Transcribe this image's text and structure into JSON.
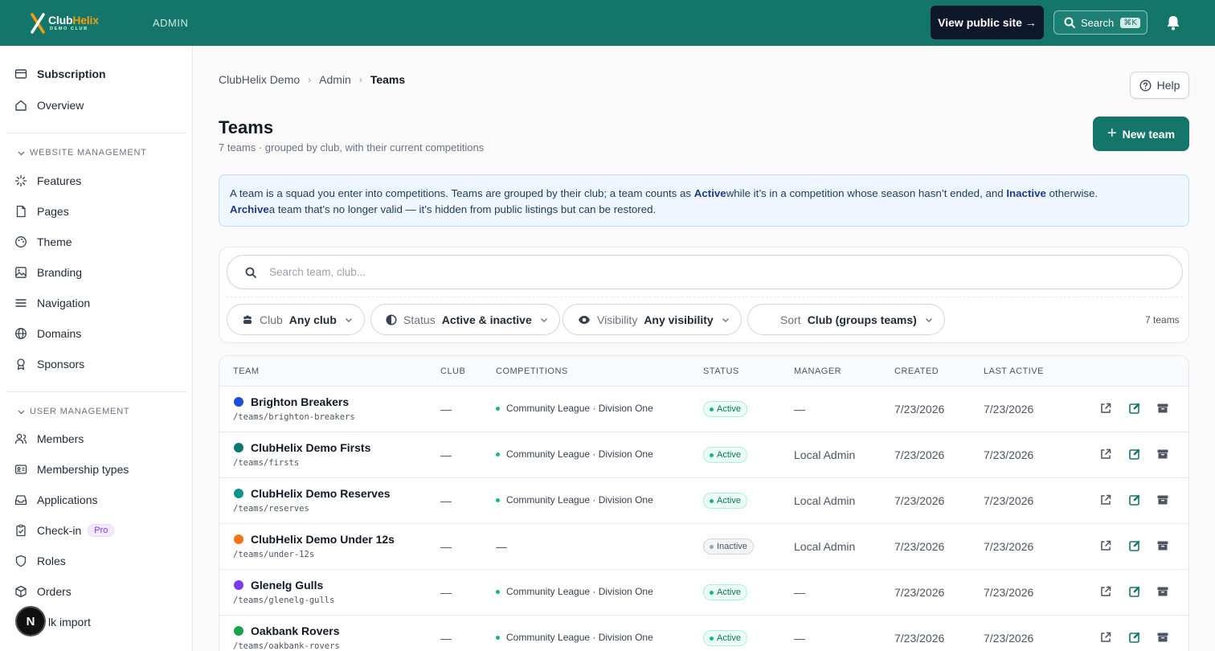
{
  "app": {
    "logo_name_a": "Club",
    "logo_name_b": "Helix",
    "logo_sub": "DEMO CLUB",
    "section": "ADMIN",
    "view_public": "View public site →",
    "search_label": "Search",
    "search_kbd": "⌘K",
    "accent": "#14756b"
  },
  "sidebar": {
    "top_items": [
      {
        "label": "Subscription",
        "icon": "card-icon"
      },
      {
        "label": "Overview",
        "icon": "house-icon"
      }
    ],
    "website_section": "WEBSITE MANAGEMENT",
    "website_items": [
      {
        "label": "Features",
        "icon": "sparkle-icon"
      },
      {
        "label": "Pages",
        "icon": "file-icon"
      },
      {
        "label": "Theme",
        "icon": "palette-icon"
      },
      {
        "label": "Branding",
        "icon": "image-icon"
      },
      {
        "label": "Navigation",
        "icon": "menu-icon"
      },
      {
        "label": "Domains",
        "icon": "globe-icon"
      },
      {
        "label": "Sponsors",
        "icon": "award-icon"
      }
    ],
    "user_section": "USER MANAGEMENT",
    "user_items": [
      {
        "label": "Members",
        "icon": "users-icon"
      },
      {
        "label": "Membership types",
        "icon": "id-card-icon"
      },
      {
        "label": "Applications",
        "icon": "inbox-icon"
      },
      {
        "label": "Check-in",
        "icon": "clipboard-check-icon",
        "badge": "Pro"
      },
      {
        "label": "Roles",
        "icon": "shield-icon"
      },
      {
        "label": "Orders",
        "icon": "box-icon"
      },
      {
        "label": "lk import",
        "icon": "upload-icon"
      }
    ],
    "avatar_letter": "N"
  },
  "breadcrumb": [
    "ClubHelix Demo",
    "Admin",
    "Teams"
  ],
  "help_label": "Help",
  "page": {
    "title": "Teams",
    "subtitle": "7 teams · grouped by club, with their current competitions",
    "new_button": "New team"
  },
  "info": {
    "t1": "A team is a squad you enter into competitions. Teams are grouped by their club; a team counts as ",
    "b1": "Active",
    "t2": "while it’s in a competition whose season hasn’t ended, and ",
    "b2": "Inactive",
    "t3": " otherwise.",
    "b3": "Archive",
    "t4": "a team that’s no longer valid — it’s hidden from public listings but can be restored."
  },
  "filters": {
    "search_placeholder": "Search team, club...",
    "club_label": "Club",
    "club_value": "Any club",
    "status_label": "Status",
    "status_value": "Active & inactive",
    "visibility_label": "Visibility",
    "visibility_value": "Any visibility",
    "sort_label": "Sort",
    "sort_value": "Club (groups teams)",
    "count": "7 teams"
  },
  "table": {
    "columns": [
      "TEAM",
      "CLUB",
      "COMPETITIONS",
      "STATUS",
      "MANAGER",
      "CREATED",
      "LAST ACTIVE"
    ],
    "rows": [
      {
        "name": "Brighton Breakers",
        "slug": "/teams/brighton-breakers",
        "color": "#1d4ed8",
        "club": "—",
        "competition": "Community League · Division One",
        "status": "Active",
        "manager": "—",
        "created": "7/23/2026",
        "last_active": "7/23/2026"
      },
      {
        "name": "ClubHelix Demo Firsts",
        "slug": "/teams/firsts",
        "color": "#0f766e",
        "club": "—",
        "competition": "Community League · Division One",
        "status": "Active",
        "manager": "Local Admin",
        "created": "7/23/2026",
        "last_active": "7/23/2026"
      },
      {
        "name": "ClubHelix Demo Reserves",
        "slug": "/teams/reserves",
        "color": "#0d9488",
        "club": "—",
        "competition": "Community League · Division One",
        "status": "Active",
        "manager": "Local Admin",
        "created": "7/23/2026",
        "last_active": "7/23/2026"
      },
      {
        "name": "ClubHelix Demo Under 12s",
        "slug": "/teams/under-12s",
        "color": "#f97316",
        "club": "—",
        "competition": "—",
        "status": "Inactive",
        "manager": "Local Admin",
        "created": "7/23/2026",
        "last_active": "7/23/2026"
      },
      {
        "name": "Glenelg Gulls",
        "slug": "/teams/glenelg-gulls",
        "color": "#7c3aed",
        "club": "—",
        "competition": "Community League · Division One",
        "status": "Active",
        "manager": "—",
        "created": "7/23/2026",
        "last_active": "7/23/2026"
      },
      {
        "name": "Oakbank Rovers",
        "slug": "/teams/oakbank-rovers",
        "color": "#16a34a",
        "club": "—",
        "competition": "Community League · Division One",
        "status": "Active",
        "manager": "—",
        "created": "7/23/2026",
        "last_active": "7/23/2026"
      }
    ]
  }
}
